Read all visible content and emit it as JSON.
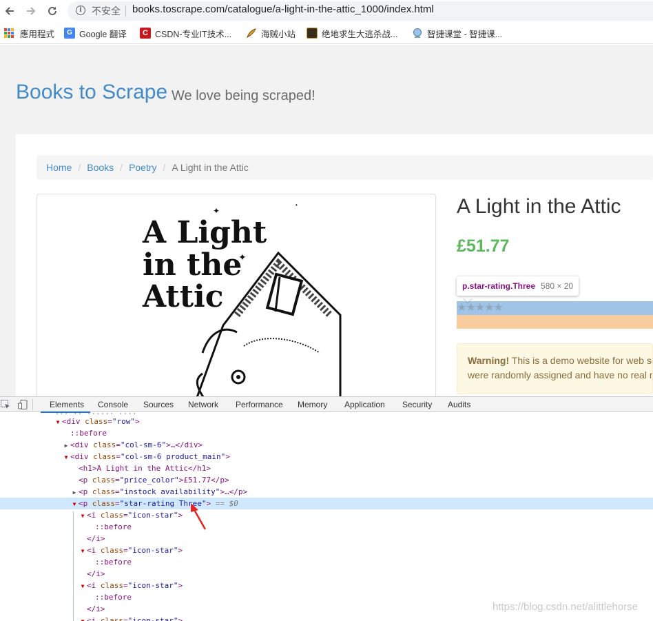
{
  "browser": {
    "security_label": "不安全",
    "url": "books.toscrape.com/catalogue/a-light-in-the-attic_1000/index.html",
    "bookmarks": [
      {
        "label": "應用程式",
        "icon": "apps-grid-icon"
      },
      {
        "label": "Google 翻译",
        "icon": "google-translate-icon"
      },
      {
        "label": "CSDN-专业IT技术...",
        "icon": "csdn-icon"
      },
      {
        "label": "海贼小站",
        "icon": "feather-icon"
      },
      {
        "label": "绝地求生大逃杀战...",
        "icon": "game-icon"
      },
      {
        "label": "智捷课堂 - 智捷课...",
        "icon": "globe-icon"
      }
    ]
  },
  "site": {
    "title": "Books to Scrape",
    "tagline": "We love being scraped!",
    "breadcrumb": [
      "Home",
      "Books",
      "Poetry"
    ],
    "breadcrumb_active": "A Light in the Attic",
    "book_cover_text": [
      "A Light",
      "in the",
      "Attic"
    ],
    "product_title": "A Light in the Attic",
    "price": "£51.77",
    "warning_strong": "Warning!",
    "warning_line1": " This is a demo website for web sc",
    "warning_line2": "were randomly assigned and have no real m"
  },
  "inspector": {
    "selector": "p.star-rating.Three",
    "dims": "580 × 20",
    "stars": "★★★★★",
    "stars_filled_color": "#8fa6bc"
  },
  "devtools": {
    "tabs": [
      "Elements",
      "Console",
      "Sources",
      "Network",
      "Performance",
      "Memory",
      "Application",
      "Security",
      "Audits"
    ],
    "active_tab": "Elements",
    "lines": {
      "l0": "<div class=\"row\">",
      "l1": "::before",
      "l2": "<div class=\"col-sm-6\">…</div>",
      "l3": "<div class=\"col-sm-6 product_main\">",
      "l4": "<h1>A Light in the Attic</h1>",
      "l5": "<p class=\"price_color\">£51.77</p>",
      "l6": "<p class=\"instock availability\">…</p>",
      "l7": "<p class=\"star-rating Three\"> == $0",
      "l8": "<i class=\"icon-star\">",
      "l9": "::before",
      "l10": "</i>"
    }
  },
  "watermark": "https://blog.csdn.net/alittlehorse",
  "colors": {
    "link": "#428bca",
    "price": "#5cb85c",
    "tag": "#881280",
    "attr_name": "#994500",
    "attr_value": "#1a1aa6",
    "selected_row": "#cfe8fc"
  }
}
